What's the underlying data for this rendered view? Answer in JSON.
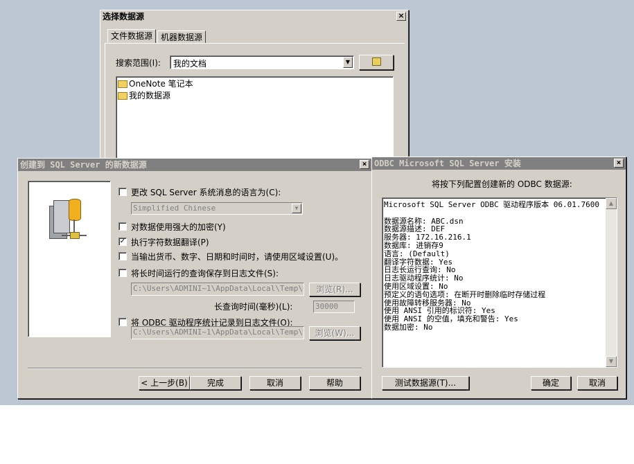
{
  "source_dialog": {
    "title": "选择数据源",
    "tabs": [
      "文件数据源",
      "机器数据源"
    ],
    "search_label": "搜索范围(I):",
    "search_value": "我的文档",
    "items": [
      "OneNote 笔记本",
      "我的数据源"
    ]
  },
  "create_dialog": {
    "title": "创建到 SQL Server 的新数据源",
    "change_language_label": "更改 SQL Server 系统消息的语言为(C):",
    "language_value": "Simplified Chinese",
    "strong_encryption_label": "对数据使用强大的加密(Y)",
    "translate_label": "执行字符数据翻译(P)",
    "regional_label": "当输出货币、数字、日期和时间时，请使用区域设置(U)。",
    "long_query_label": "将长时间运行的查询保存到日志文件(S):",
    "long_query_path": "C:\\Users\\ADMINI~1\\AppData\\Local\\Temp\\QUER",
    "browse1": "浏览(R)...",
    "long_query_time_label": "长查询时间(毫秒)(L):",
    "long_query_time_value": "30000",
    "driver_stats_label": "将 ODBC 驱动程序统计记录到日志文件(O):",
    "driver_stats_path": "C:\\Users\\ADMINI~1\\AppData\\Local\\Temp\\STAT",
    "browse2": "浏览(W)...",
    "back_button": "< 上一步(B)",
    "finish_button": "完成",
    "cancel_button": "取消",
    "help_button": "帮助",
    "checks": {
      "change_language": false,
      "strong_encryption": false,
      "translate": true,
      "regional": false,
      "long_query": false,
      "driver_stats": false
    }
  },
  "setup_dialog": {
    "title": "ODBC Microsoft SQL Server 安装",
    "heading": "将按下列配置创建新的 ODBC 数据源:",
    "lines": [
      "Microsoft SQL Server ODBC 驱动程序版本 06.01.7600",
      "",
      "数据源名称: ABC.dsn",
      "数据源描述: DEF",
      "服务器: 172.16.216.1",
      "数据库: 进销存9",
      "语言: (Default)",
      "翻译字符数据: Yes",
      "日志长运行查询: No",
      "日志驱动程序统计: No",
      "使用区域设置: No",
      "预定义的语句选项: 在断开时删除临时存储过程",
      "使用故障转移服务器: No",
      "使用 ANSI 引用的标识符: Yes",
      "使用 ANSI 的空值，填充和警告: Yes",
      "数据加密: No"
    ],
    "test_button": "测试数据源(T)...",
    "ok_button": "确定",
    "cancel_button": "取消"
  }
}
